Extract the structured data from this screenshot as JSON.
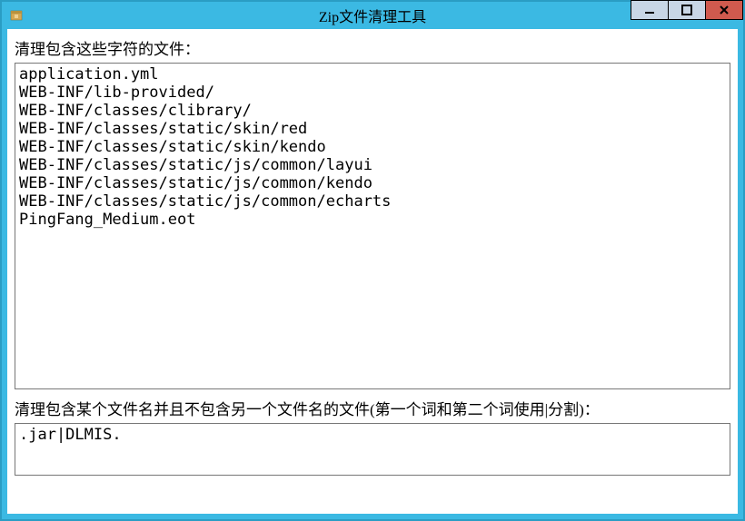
{
  "window": {
    "title": "Zip文件清理工具"
  },
  "section1": {
    "label": "清理包含这些字符的文件：",
    "content": "application.yml\nWEB-INF/lib-provided/\nWEB-INF/classes/clibrary/\nWEB-INF/classes/static/skin/red\nWEB-INF/classes/static/skin/kendo\nWEB-INF/classes/static/js/common/layui\nWEB-INF/classes/static/js/common/kendo\nWEB-INF/classes/static/js/common/echarts\nPingFang_Medium.eot"
  },
  "section2": {
    "label": "清理包含某个文件名并且不包含另一个文件名的文件(第一个词和第二个词使用|分割)：",
    "content": ".jar|DLMIS."
  }
}
